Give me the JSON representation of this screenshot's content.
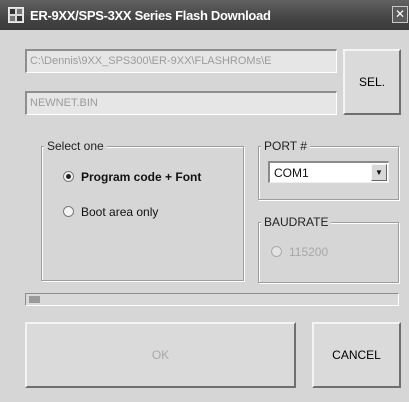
{
  "window": {
    "title": "ER-9XX/SPS-3XX Series Flash Download",
    "close_glyph": "✕",
    "app_icon": "flash-download-app-icon"
  },
  "files": {
    "path_1": "C:\\Dennis\\9XX_SPS300\\ER-9XX\\FLASHROMs\\E",
    "path_2": "NEWNET.BIN",
    "select_label": "SEL."
  },
  "select_one": {
    "legend": "Select one",
    "options": [
      {
        "label": "Program code + Font",
        "checked": true
      },
      {
        "label": "Boot area only",
        "checked": false
      }
    ]
  },
  "port": {
    "legend": "PORT #",
    "value": "COM1",
    "dropdown_icon": "chevron-down-icon"
  },
  "baudrate": {
    "legend": "BAUDRATE",
    "option": "115200",
    "disabled": true
  },
  "progress": {
    "value": 0.03
  },
  "buttons": {
    "ok": "OK",
    "cancel": "CANCEL"
  },
  "colors": {
    "title_bar": "#444444",
    "window_bg": "#d6d6d6",
    "disabled_text": "#a8a8a8"
  }
}
